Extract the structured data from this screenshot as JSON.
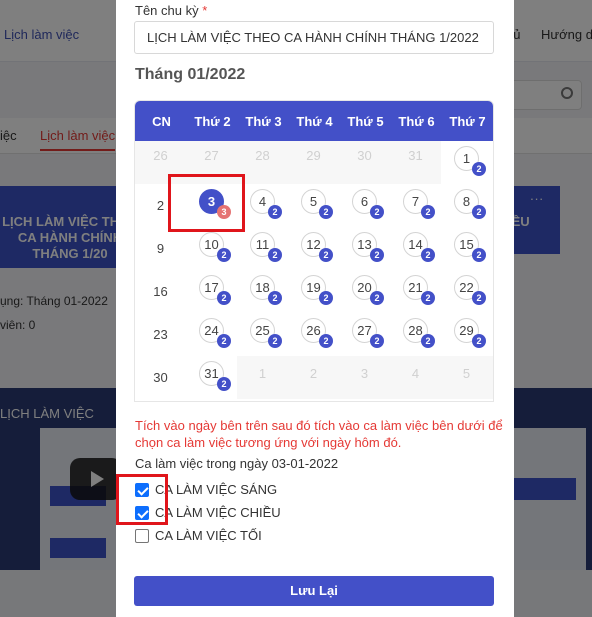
{
  "background": {
    "nav_left_link": "Lịch làm việc",
    "nav_right_1": "hủ",
    "nav_right_2": "Hướng dẫ",
    "tab_1": "iệc",
    "tab_2": "Lịch làm việc",
    "card_title": "LỊCH LÀM VIỆC THEO CA HÀNH CHÍNH THÁNG 1/20",
    "card_right_title": "IỀU",
    "card_dots": "...",
    "info_line_1": "ụng: Tháng 01-2022",
    "info_line_2": "viên: 0",
    "video_title": "LỊCH LÀM VIỆC"
  },
  "form": {
    "name_label": "Tên chu kỳ",
    "required_mark": "*",
    "name_value": "LỊCH LÀM VIỆC THEO CA HÀNH CHÍNH THÁNG 1/2022",
    "month_title": "Tháng 01/2022",
    "weekdays": [
      "CN",
      "Thứ 2",
      "Thứ 3",
      "Thứ 4",
      "Thứ 5",
      "Thứ 6",
      "Thứ 7"
    ],
    "calendar": {
      "prev_month_days": [
        "26",
        "27",
        "28",
        "29",
        "30",
        "31"
      ],
      "next_month_days": [
        "1",
        "2",
        "3",
        "4",
        "5"
      ],
      "weeks": [
        {
          "sunday": "",
          "days": [
            null,
            null,
            null,
            null,
            null,
            null,
            {
              "day": "1",
              "count": "2"
            }
          ]
        },
        {
          "sunday": "2",
          "days": [
            {
              "day": "3",
              "count": "3",
              "selected": true
            },
            {
              "day": "4",
              "count": "2"
            },
            {
              "day": "5",
              "count": "2"
            },
            {
              "day": "6",
              "count": "2"
            },
            {
              "day": "7",
              "count": "2"
            },
            {
              "day": "8",
              "count": "2"
            }
          ]
        },
        {
          "sunday": "9",
          "days": [
            {
              "day": "10",
              "count": "2"
            },
            {
              "day": "11",
              "count": "2"
            },
            {
              "day": "12",
              "count": "2"
            },
            {
              "day": "13",
              "count": "2"
            },
            {
              "day": "14",
              "count": "2"
            },
            {
              "day": "15",
              "count": "2"
            }
          ]
        },
        {
          "sunday": "16",
          "days": [
            {
              "day": "17",
              "count": "2"
            },
            {
              "day": "18",
              "count": "2"
            },
            {
              "day": "19",
              "count": "2"
            },
            {
              "day": "20",
              "count": "2"
            },
            {
              "day": "21",
              "count": "2"
            },
            {
              "day": "22",
              "count": "2"
            }
          ]
        },
        {
          "sunday": "23",
          "days": [
            {
              "day": "24",
              "count": "2"
            },
            {
              "day": "25",
              "count": "2"
            },
            {
              "day": "26",
              "count": "2"
            },
            {
              "day": "27",
              "count": "2"
            },
            {
              "day": "28",
              "count": "2"
            },
            {
              "day": "29",
              "count": "2"
            }
          ]
        },
        {
          "sunday": "30",
          "days": [
            {
              "day": "31",
              "count": "2"
            }
          ]
        }
      ]
    },
    "hint": "Tích vào ngày bên trên sau đó tích vào ca làm việc bên dưới để chọn ca làm việc tương ứng với ngày hôm đó.",
    "shifts_title": "Ca làm việc trong ngày 03-01-2022",
    "shifts": [
      {
        "label": "CA LÀM VIỆC SÁNG",
        "checked": true
      },
      {
        "label": "CA LÀM VIỆC CHIỀU",
        "checked": true
      },
      {
        "label": "CA LÀM VIỆC TỐI",
        "checked": false
      }
    ],
    "save_label": "Lưu Lại"
  },
  "colors": {
    "primary": "#4350c8",
    "hint_red": "#e53935",
    "highlight_red": "#e0151b",
    "checkbox_blue": "#0d6efd"
  }
}
